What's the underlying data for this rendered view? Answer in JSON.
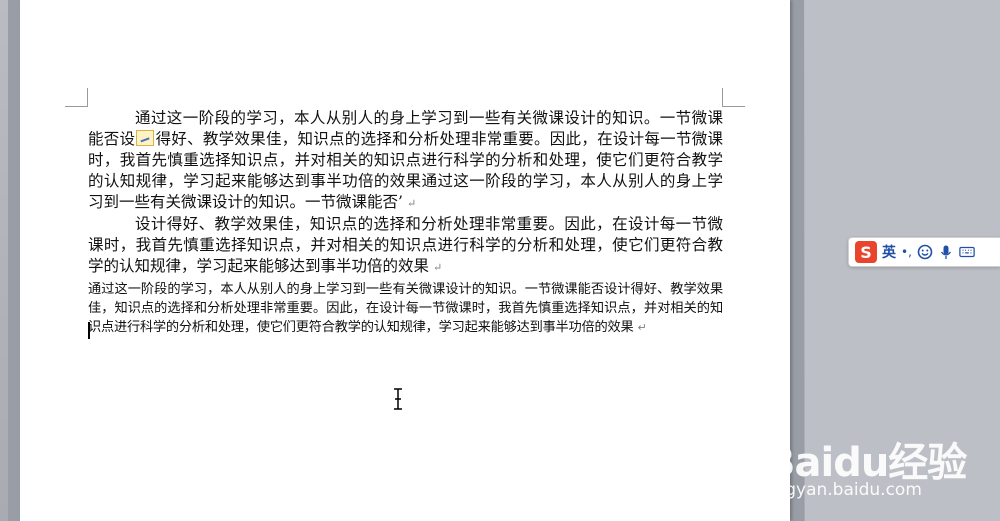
{
  "document": {
    "paragraphs": [
      "通过这一阶段的学习，本人从别人的身上学习到一些有关微课设计的知识。一节微课能否设",
      "得好、教学效果佳，知识点的选择和分析处理非常重要。因此，在设计每一节微课时，我首先慎重选择知识点，并对相关的知识点进行科学的分析和处理，使它们更符合教学的认知规律，学习起来能够达到事半功倍的效果通过这一阶段的学习，本人从别人的身上学习到一些有关微课设计的知识。一节微课能否’",
      "设计得好、教学效果佳，知识点的选择和分析处理非常重要。因此，在设计每一节微课时，我首先慎重选择知识点，并对相关的知识点进行科学的分析和处理，使它们更符合教学的认知规律，学习起来能够达到事半功倍的效果",
      "通过这一阶段的学习，本人从别人的身上学习到一些有关微课设计的知识。一节微课能否设计得好、教学效果佳，知识点的选择和分析处理非常重要。因此，在设计每一节微课时，我首先慎重选择知识点，并对相关的知识点进行科学的分析和处理，使它们更符合教学的认知规律，学习起来能够达到事半功倍的效果"
    ],
    "para_mark": "↵"
  },
  "ime": {
    "logo": "S",
    "lang": "英",
    "punct": "•,",
    "icons": [
      "emoji-icon",
      "microphone-icon",
      "keyboard-icon"
    ]
  },
  "watermark": {
    "main": "Baidu经验",
    "sub": "jingyan.baidu.com"
  }
}
